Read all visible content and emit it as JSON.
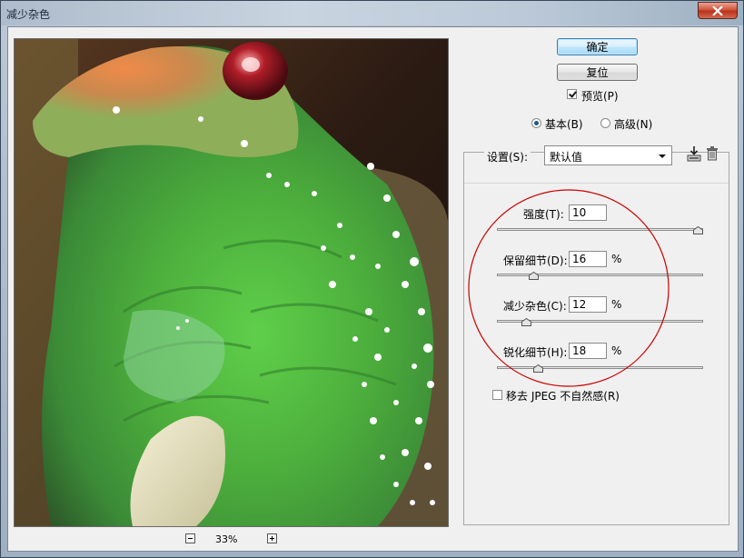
{
  "window": {
    "title": "减少杂色"
  },
  "preview": {
    "zoom_level": "33%"
  },
  "buttons": {
    "ok_label": "确定",
    "reset_label": "复位"
  },
  "preview_toggle": {
    "label": "预览(P)",
    "checked": true
  },
  "mode": {
    "options": [
      {
        "label": "基本(B)",
        "selected": true
      },
      {
        "label": "高级(N)",
        "selected": false
      }
    ]
  },
  "settings": {
    "label": "设置(S):",
    "selected_value": "默认值"
  },
  "params": [
    {
      "label": "强度(T):",
      "value": "10",
      "unit": "",
      "max": 10
    },
    {
      "label": "保留细节(D):",
      "value": "16",
      "unit": "%",
      "max": 100
    },
    {
      "label": "减少杂色(C):",
      "value": "12",
      "unit": "%",
      "max": 100
    },
    {
      "label": "锐化细节(H):",
      "value": "18",
      "unit": "%",
      "max": 100
    }
  ],
  "jpeg_artifact": {
    "label": "移去 JPEG 不自然感(R)",
    "checked": false
  },
  "colors": {
    "annotation_circle": "#cc0000",
    "default_button_border": "#3c7fb1"
  }
}
